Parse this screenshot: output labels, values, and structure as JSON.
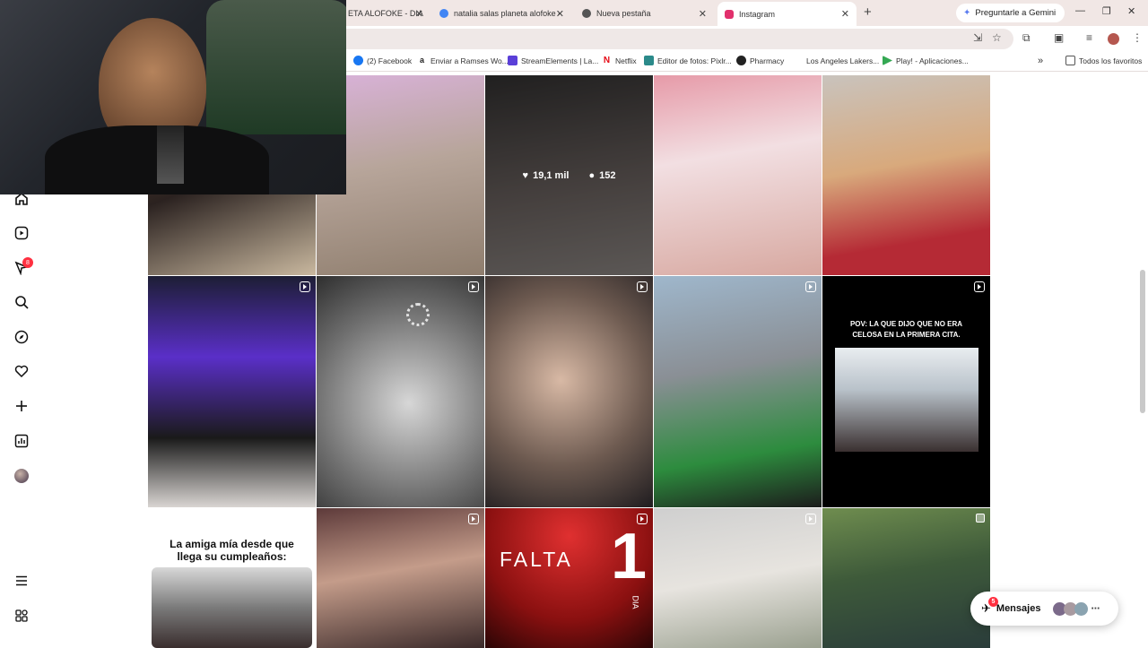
{
  "browser": {
    "tabs": [
      {
        "title": "ETA ALOFOKE - DIA",
        "favicon_color": "#e03a3a"
      },
      {
        "title": "natalia salas planeta alofoke -",
        "favicon_color": "#4285f4"
      },
      {
        "title": "Nueva pestaña",
        "favicon_color": "#555555"
      },
      {
        "title": "Instagram",
        "favicon_color": "#e1306c"
      }
    ],
    "new_tab_icon": "plus-icon",
    "gemini_label": "Preguntarle a Gemini",
    "bookmarks": [
      {
        "label": "(2) Facebook",
        "color": "#1877f2"
      },
      {
        "label": "Enviar a Ramses Wo...",
        "color": "#222222"
      },
      {
        "label": "StreamElements | La...",
        "color": "#5a3fd8"
      },
      {
        "label": "Netflix",
        "color": "#e50914"
      },
      {
        "label": "Editor de fotos: Pixlr...",
        "color": "#2b8a8a"
      },
      {
        "label": "Pharmacy",
        "color": "#222222"
      },
      {
        "label": "Los Angeles Lakers...",
        "color": "#ffffff"
      },
      {
        "label": "Play! - Aplicaciones...",
        "color": "#34a853"
      }
    ],
    "all_bookmarks": "Todos los favoritos"
  },
  "sidebar": {
    "icons": [
      "home-icon",
      "reels-icon",
      "messenger-icon",
      "search-icon",
      "explore-icon",
      "heart-icon",
      "create-icon",
      "insights-icon",
      "profile-avatar",
      "menu-icon",
      "threads-icon"
    ],
    "notification_count": "8"
  },
  "grid": {
    "hover_post": {
      "likes": "19,1 mil",
      "comments": "152"
    },
    "texts": {
      "pov_caption": "POV: LA QUE DIJO QUE NO ERA CELOSA EN LA PRIMERA CITA.",
      "birthday_caption": "La amiga mía desde que llega su cumpleaños:",
      "falta": "FALTA",
      "falta_number": "1",
      "falta_dia": "DIA"
    }
  },
  "messages": {
    "label": "Mensajes",
    "badge": "5"
  },
  "colors": {
    "accent": "#ff3040",
    "instagram": "#e1306c"
  }
}
